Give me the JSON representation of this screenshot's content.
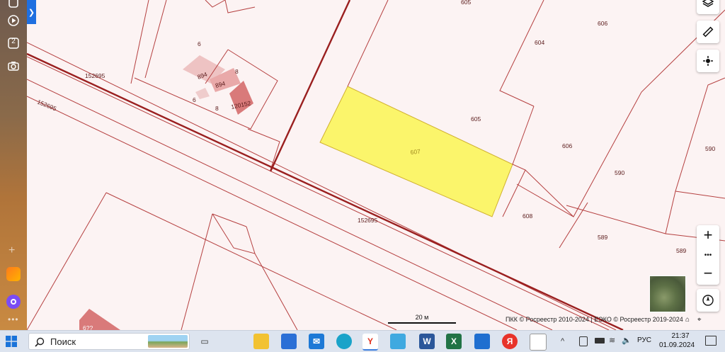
{
  "map": {
    "parcel_labels": {
      "p605_top": "605",
      "p606_top": "606",
      "p604": "604",
      "p6_a": "6",
      "p8_a": "8",
      "p894_a": "894",
      "p894_b": "894",
      "p6_b": "6",
      "p8_b": "8",
      "p120152": "120152",
      "p152695_a": "152695",
      "p152695_b": "152695",
      "p152695_c": "152695",
      "p605": "605",
      "p606": "606",
      "p590_a": "590",
      "p590_b": "590",
      "p607": "607",
      "p608": "608",
      "p589_a": "589",
      "p589_b": "589",
      "p6xx": "6??"
    },
    "highlight_color": "#fbf56b",
    "boundary_color": "#b42828"
  },
  "scale": {
    "label": "20 м"
  },
  "copyright": "ПКК © Росреестр 2010-2024 | ЕЭКО © Росреестр 2019-2024",
  "controls": {
    "layers_icon": "layers-icon",
    "ruler_icon": "ruler-icon",
    "locate_icon": "crosshair-icon",
    "zoom_in": "+",
    "zoom_more": "•••",
    "zoom_out": "−"
  },
  "sidebar": {
    "badge": "2"
  },
  "taskbar": {
    "search_placeholder": "Поиск",
    "lang": "РУС",
    "time": "21:37",
    "date": "01.09.2024",
    "yandex_letter": "Я",
    "word_letter": "W",
    "excel_letter": "X"
  }
}
